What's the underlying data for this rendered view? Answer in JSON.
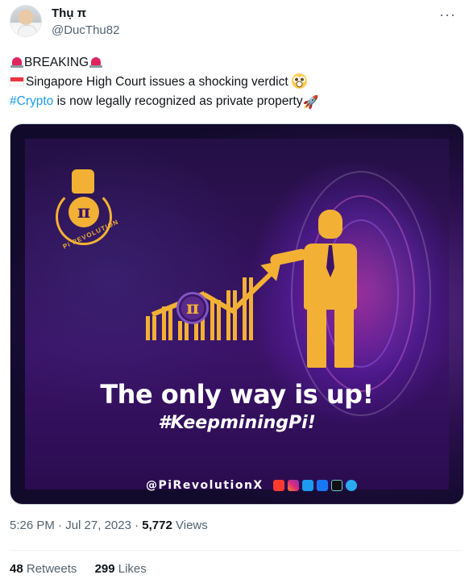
{
  "author": {
    "name": "Thụ π",
    "handle": "@DucThu82",
    "more_icon": "more-horizontal-icon"
  },
  "tweet": {
    "line1": "BREAKING",
    "line2": "Singapore High Court issues a shocking verdict",
    "line3_hashtag": "#Crypto",
    "line3_rest": " is now legally recognized as private property"
  },
  "media": {
    "logo_text": "Pi REVOLUTION",
    "pi_symbol": "π",
    "headline": "The only way is up!",
    "subline": "#KeepminingPi!",
    "social_handle": "@PiRevolutionX",
    "social_icons": [
      "youtube-icon",
      "instagram-icon",
      "twitter-icon",
      "facebook-icon",
      "tiktok-icon",
      "telegram-icon"
    ]
  },
  "meta": {
    "time": "5:26 PM",
    "sep1": " · ",
    "date": "Jul 27, 2023",
    "sep2": " · ",
    "views_count": "5,772",
    "views_label": " Views"
  },
  "stats": {
    "retweets_count": "48",
    "retweets_label": " Retweets",
    "likes_count": "299",
    "likes_label": " Likes"
  },
  "colors": {
    "link": "#1d9bf0",
    "brand_gold": "#f2b134",
    "brand_purple": "#3b1368"
  }
}
